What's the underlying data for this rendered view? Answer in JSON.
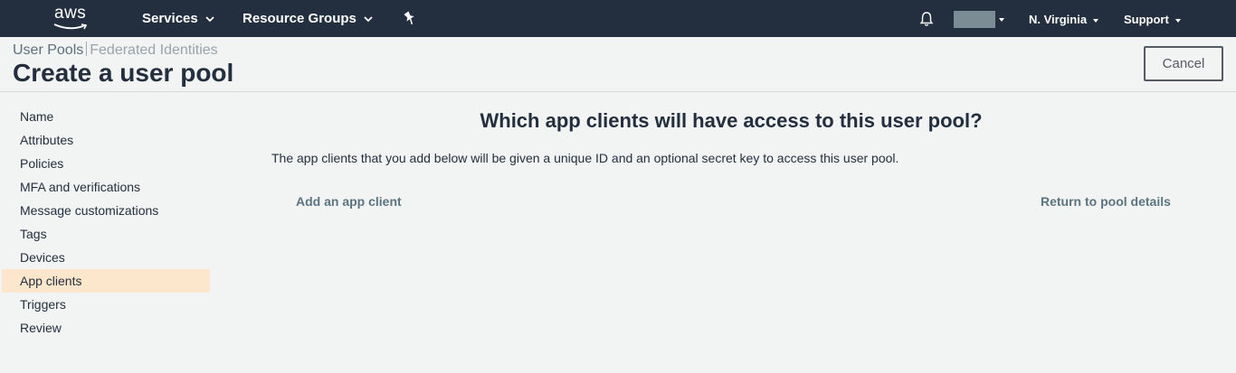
{
  "topnav": {
    "logo_text": "aws",
    "services_label": "Services",
    "resource_groups_label": "Resource Groups",
    "pin_icon": "pin-icon",
    "bell_icon": "bell-icon",
    "region_label": "N. Virginia",
    "support_label": "Support",
    "background_color": "#232f3e"
  },
  "header": {
    "breadcrumb": {
      "user_pools": "User Pools",
      "federated_identities": "Federated Identities"
    },
    "title": "Create a user pool",
    "cancel_label": "Cancel"
  },
  "sidebar": {
    "items": [
      {
        "label": "Name"
      },
      {
        "label": "Attributes"
      },
      {
        "label": "Policies"
      },
      {
        "label": "MFA and verifications"
      },
      {
        "label": "Message customizations"
      },
      {
        "label": "Tags"
      },
      {
        "label": "Devices"
      },
      {
        "label": "App clients",
        "active": true
      },
      {
        "label": "Triggers"
      },
      {
        "label": "Review"
      }
    ],
    "active_color": "#fde7cc"
  },
  "main": {
    "heading": "Which app clients will have access to this user pool?",
    "description": "The app clients that you add below will be given a unique ID and an optional secret key to access this user pool.",
    "add_client_label": "Add an app client",
    "return_label": "Return to pool details",
    "link_color": "#5b7480"
  }
}
